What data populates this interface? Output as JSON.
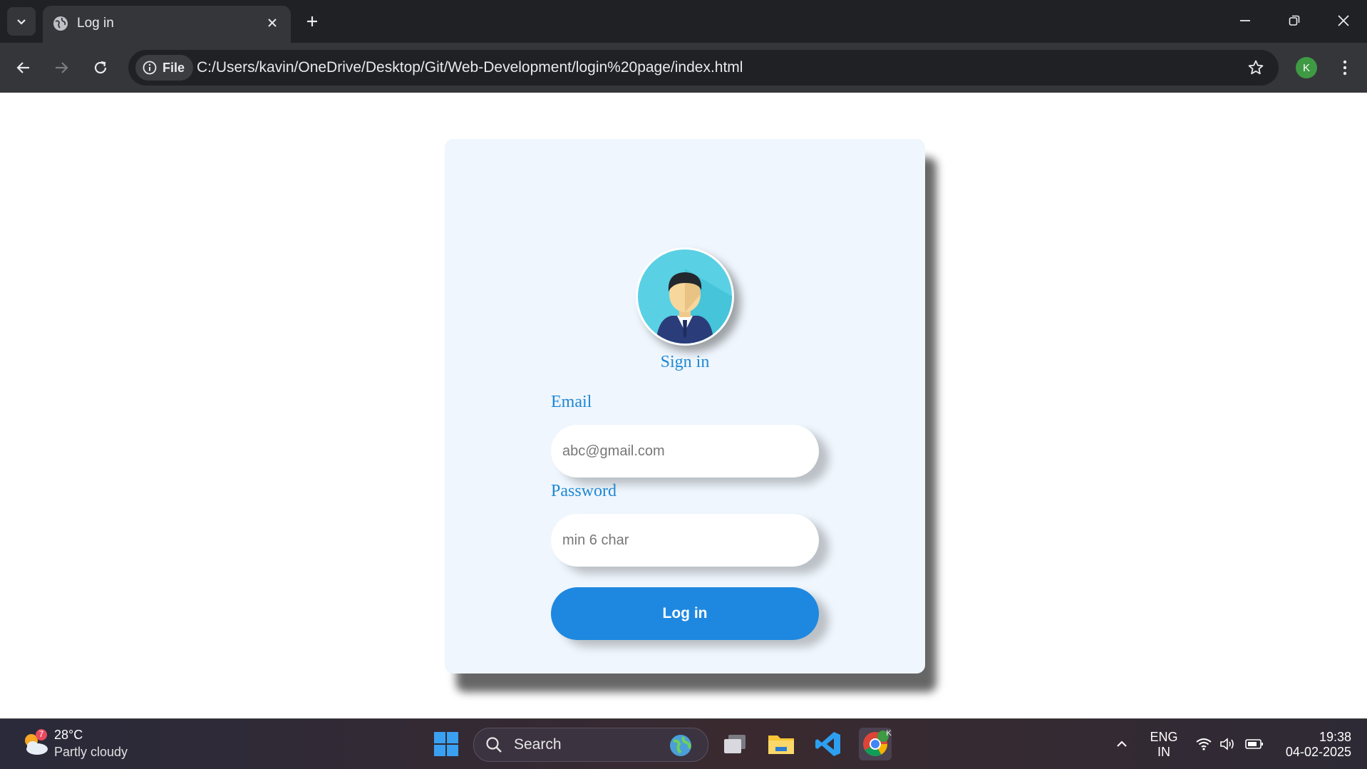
{
  "browser": {
    "tab_title": "Log in",
    "chip_label": "File",
    "url": "C:/Users/kavin/OneDrive/Desktop/Git/Web-Development/login%20page/index.html",
    "profile_initial": "K"
  },
  "login": {
    "heading": "Sign in",
    "email_label": "Email",
    "email_placeholder": "abc@gmail.com",
    "password_label": "Password",
    "password_placeholder": "min 6 char",
    "button_label": "Log in"
  },
  "taskbar": {
    "weather_badge": "7",
    "temperature": "28°C",
    "weather_desc": "Partly cloudy",
    "search_label": "Search",
    "lang_line1": "ENG",
    "lang_line2": "IN",
    "time": "19:38",
    "date": "04-02-2025",
    "chrome_badge": "K"
  },
  "colors": {
    "accent": "#1e88e0",
    "heading": "#1e88d4",
    "card_bg": "#eff6fd"
  }
}
